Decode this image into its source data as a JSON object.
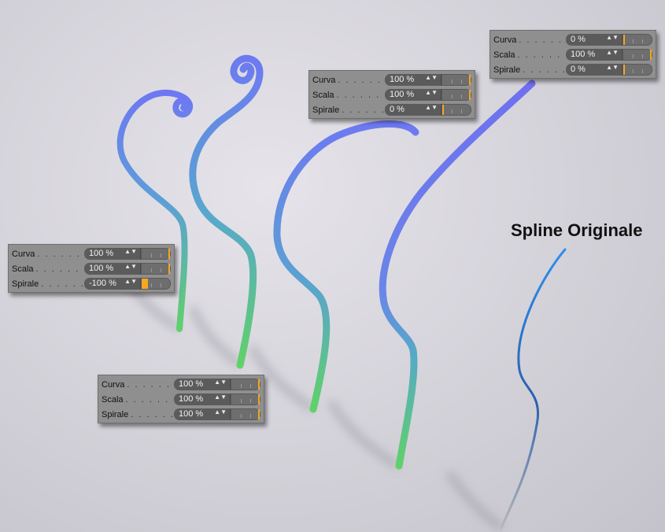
{
  "title": "Spline Originale",
  "panels": [
    {
      "id": "top-right",
      "rows": [
        {
          "label": "Curva",
          "value": "0 %",
          "level": 0
        },
        {
          "label": "Scala",
          "value": "100 %",
          "level": 1
        },
        {
          "label": "Spirale",
          "value": "0 %",
          "level": 0
        }
      ]
    },
    {
      "id": "upper-middle",
      "rows": [
        {
          "label": "Curva",
          "value": "100 %",
          "level": 1
        },
        {
          "label": "Scala",
          "value": "100 %",
          "level": 1
        },
        {
          "label": "Spirale",
          "value": "0 %",
          "level": 0
        }
      ]
    },
    {
      "id": "left",
      "rows": [
        {
          "label": "Curva",
          "value": "100 %",
          "level": 1
        },
        {
          "label": "Scala",
          "value": "100 %",
          "level": 1
        },
        {
          "label": "Spirale",
          "value": "-100 %",
          "level": -1
        }
      ]
    },
    {
      "id": "bottom",
      "rows": [
        {
          "label": "Curva",
          "value": "100 %",
          "level": 1
        },
        {
          "label": "Scala",
          "value": "100 %",
          "level": 1
        },
        {
          "label": "Spirale",
          "value": "100 %",
          "level": 1
        }
      ]
    }
  ],
  "colors": {
    "accent": "#f5a623",
    "panel": "#8f8f8f",
    "field": "#5b5b5b",
    "tube_top": "#6f7ff0",
    "tube_bottom": "#5fd06a",
    "spline": "#2f7fe0"
  }
}
